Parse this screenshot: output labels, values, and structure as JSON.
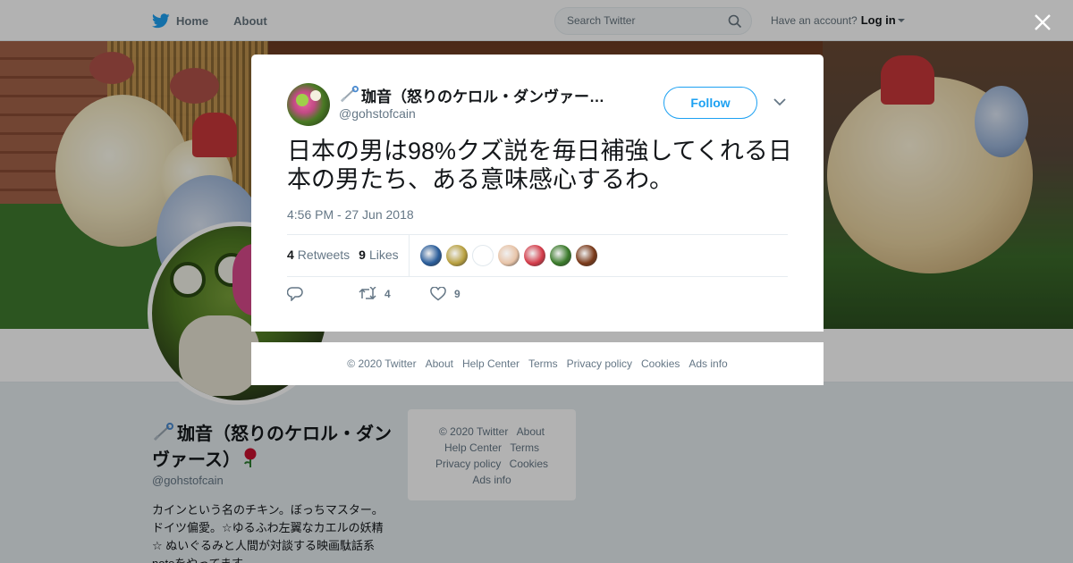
{
  "nav": {
    "home": "Home",
    "about": "About",
    "search_placeholder": "Search Twitter",
    "have_account": "Have an account?",
    "login": "Log in"
  },
  "profile": {
    "name": "珈音（怒りのケロル・ダンヴァース）",
    "handle": "@gohstofcain",
    "bio": "カインという名のチキン。ぼっちマスター。ドイツ偏愛。☆ゆるふわ左翼なカエルの妖精☆ ぬいぐるみと人間が対談する映画駄話系noteをやってます"
  },
  "side_footer": {
    "copyright": "© 2020 Twitter",
    "about": "About",
    "help": "Help Center",
    "terms": "Terms",
    "privacy": "Privacy policy",
    "cookies": "Cookies",
    "ads": "Ads info"
  },
  "tweet": {
    "author_name": "珈音（怒りのケロル・ダンヴァー…",
    "author_handle": "@gohstofcain",
    "follow_label": "Follow",
    "text": "日本の男は98%クズ説を毎日補強してくれる日本の男たち、ある意味感心するわ。",
    "timestamp": "4:56 PM - 27 Jun 2018",
    "retweets_count": "4",
    "retweets_label": "Retweets",
    "likes_count": "9",
    "likes_label": "Likes",
    "action_retweet_count": "4",
    "action_like_count": "9",
    "likers": [
      {
        "color": "#2a5d9a"
      },
      {
        "color": "#b8a040"
      },
      {
        "color": "#ffffff"
      },
      {
        "color": "#e8c4a8"
      },
      {
        "color": "#d43c4a"
      },
      {
        "color": "#3a7a2a"
      },
      {
        "color": "#7a3a1a"
      }
    ]
  },
  "modal_footer": {
    "copyright": "© 2020 Twitter",
    "about": "About",
    "help": "Help Center",
    "terms": "Terms",
    "privacy": "Privacy policy",
    "cookies": "Cookies",
    "ads": "Ads info"
  },
  "colors": {
    "accent": "#1da1f2",
    "muted": "#657786"
  }
}
